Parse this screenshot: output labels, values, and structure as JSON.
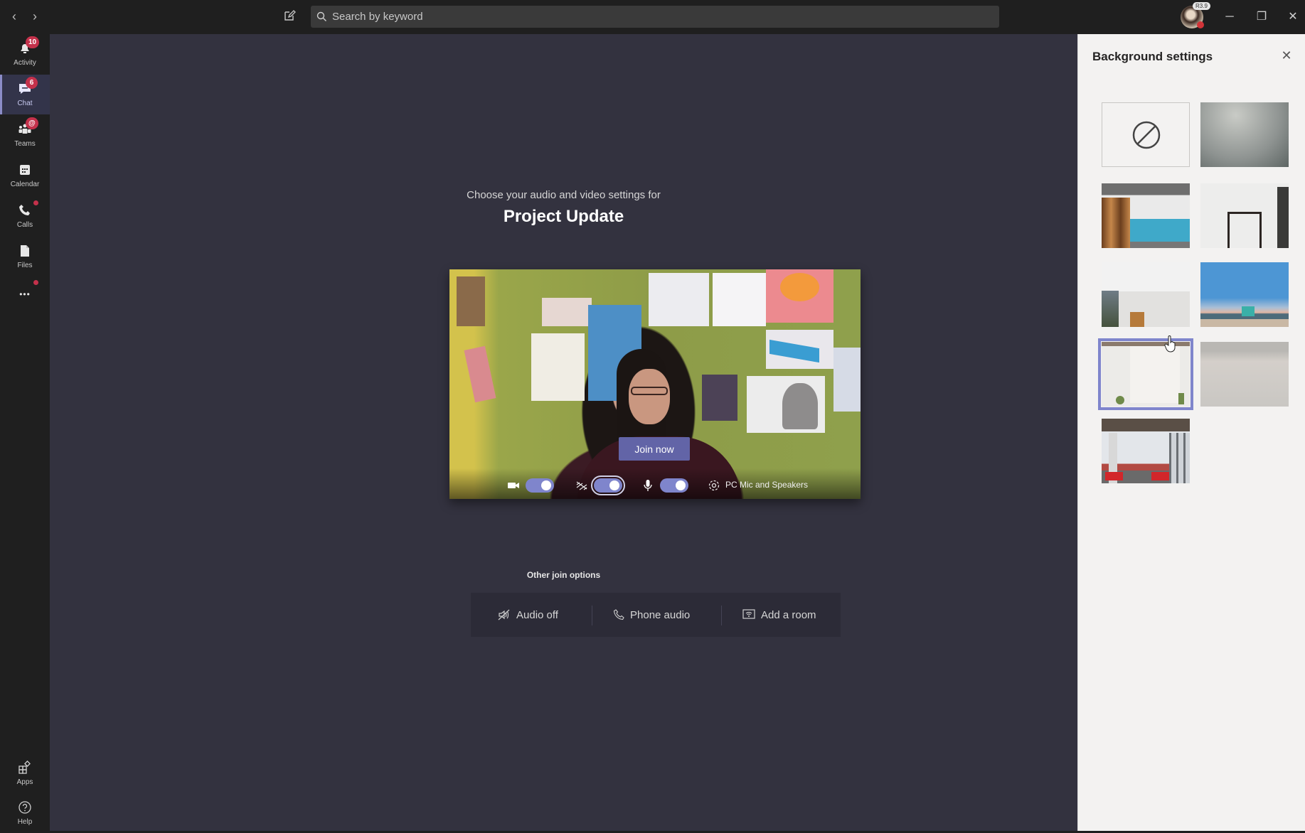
{
  "titlebar": {
    "back_icon": "chevron-left-icon",
    "forward_icon": "chevron-right-icon",
    "compose_icon": "compose-icon",
    "search": {
      "placeholder": "Search by keyword",
      "value": ""
    },
    "avatar": {
      "badge": "R3.9",
      "status": "busy"
    },
    "window_controls": {
      "minimize": "─",
      "restore": "❐",
      "close": "✕"
    }
  },
  "rail": {
    "items": [
      {
        "label": "Activity",
        "icon": "bell-icon",
        "badge": "10"
      },
      {
        "label": "Chat",
        "icon": "chat-icon",
        "badge": "6",
        "active": true
      },
      {
        "label": "Teams",
        "icon": "teams-icon",
        "badge": "@"
      },
      {
        "label": "Calendar",
        "icon": "calendar-icon"
      },
      {
        "label": "Calls",
        "icon": "phone-icon",
        "dot": true
      },
      {
        "label": "Files",
        "icon": "file-icon"
      },
      {
        "label": "",
        "icon": "more-icon",
        "dot": true
      }
    ],
    "bottom": [
      {
        "label": "Apps",
        "icon": "apps-icon"
      },
      {
        "label": "Help",
        "icon": "help-icon"
      }
    ],
    "more_glyph": "•••"
  },
  "prejoin": {
    "subtitle": "Choose your audio and video settings for",
    "meeting_title": "Project Update",
    "join_button": "Join now",
    "controls": {
      "camera_on": true,
      "background_blur_on": true,
      "mic_on": true,
      "device": "PC Mic and Speakers"
    },
    "other_options_label": "Other join options",
    "other_options": [
      {
        "label": "Audio off",
        "icon": "speaker-off-icon"
      },
      {
        "label": "Phone audio",
        "icon": "phone-icon"
      },
      {
        "label": "Add a room",
        "icon": "room-cast-icon"
      }
    ]
  },
  "background_panel": {
    "title": "Background settings",
    "close_glyph": "✕",
    "options": [
      {
        "name": "none",
        "selected": false
      },
      {
        "name": "blur",
        "selected": false
      },
      {
        "name": "office-loft-blue-wall",
        "selected": false
      },
      {
        "name": "white-room-doorway",
        "selected": false
      },
      {
        "name": "white-room-window",
        "selected": false
      },
      {
        "name": "beach-lifeguard-tower",
        "selected": false
      },
      {
        "name": "white-wall-plants",
        "selected": true
      },
      {
        "name": "blurred-wall",
        "selected": false
      },
      {
        "name": "loft-windows-red-chairs",
        "selected": false
      }
    ]
  },
  "colors": {
    "accent": "#6264a7",
    "toggle_on": "#7f85cc",
    "badge": "#c4314b",
    "stage_bg": "#33323f",
    "rail_bg": "#1f1f1f",
    "panel_bg": "#f3f2f1"
  }
}
